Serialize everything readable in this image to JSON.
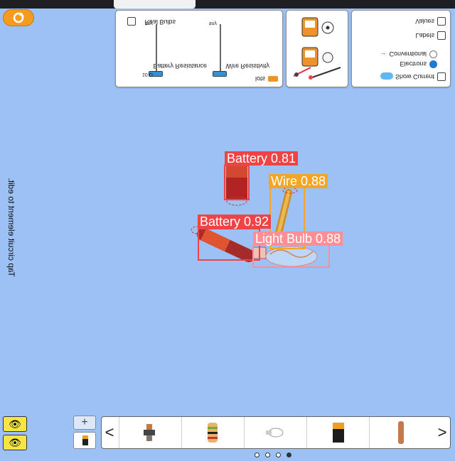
{
  "top_right_panel": {
    "show_current": "Show Current",
    "electrons": "Electrons",
    "conventional": "Conventional",
    "labels": "Labels",
    "values": "Values"
  },
  "right_slider_panel": {
    "resistivity_title": "Wire Resistivity",
    "battery_resistance_title": "Battery Resistance",
    "tiny_label_1": "tiny",
    "tiny_label_2": "tiny",
    "lots_label": "lots",
    "ohm_label": "10 Ω",
    "real_bulbs": "Real Bulbs"
  },
  "canvas_caption": "Tap circuit element to edit.",
  "detections": [
    {
      "label": "Battery 0.81",
      "color": "#ef4444"
    },
    {
      "label": "Wire 0.88",
      "color": "#f5a524"
    },
    {
      "label": "Battery 0.92",
      "color": "#ef4444"
    },
    {
      "label": "Light Bulb 0.88",
      "color": "#ff8f95"
    }
  ],
  "toolbar": {
    "items": [
      "switch",
      "resistor",
      "light bulb",
      "battery",
      "wire"
    ],
    "left_chevron": "<",
    "right_chevron": ">",
    "zoom_plus": "+"
  },
  "colors": {
    "background": "#9cc1f4",
    "battery_box": "#ef4444",
    "wire_box": "#f5a524",
    "bulb_box": "#ff8f95"
  }
}
